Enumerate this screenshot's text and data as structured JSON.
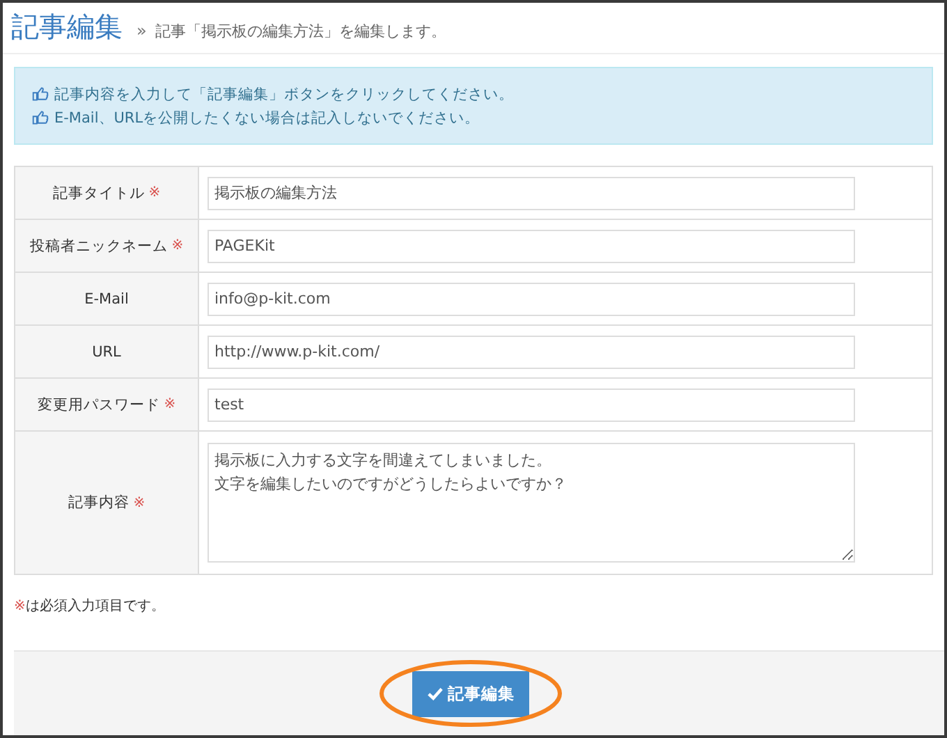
{
  "header": {
    "title": "記事編集",
    "separator": "»",
    "subtitle": "記事「掲示板の編集方法」を編集します。"
  },
  "notice": [
    "記事内容を入力して「記事編集」ボタンをクリックしてください。",
    "E-Mail、URLを公開したくない場合は記入しないでください。"
  ],
  "fields": [
    {
      "label": "記事タイトル",
      "required_mark": "※",
      "kind": "input",
      "value": "掲示板の編集方法"
    },
    {
      "label": "投稿者ニックネーム",
      "required_mark": "※",
      "kind": "input",
      "value": "PAGEKit"
    },
    {
      "label": "E-Mail",
      "kind": "input",
      "value": "info@p-kit.com"
    },
    {
      "label": "URL",
      "kind": "input",
      "value": "http://www.p-kit.com/"
    },
    {
      "label": "変更用パスワード",
      "required_mark": "※",
      "kind": "input",
      "value": "test"
    },
    {
      "label": "記事内容",
      "required_mark": "※",
      "kind": "textarea",
      "lines": [
        "掲示板に入力する文字を間違えてしまいました。",
        "文字を編集したいのですがどうしたらよいですか？"
      ]
    }
  ],
  "required_note": {
    "mark": "※",
    "text": "は必須入力項目です。"
  },
  "submit": {
    "label": "記事編集",
    "highlighted": true
  }
}
